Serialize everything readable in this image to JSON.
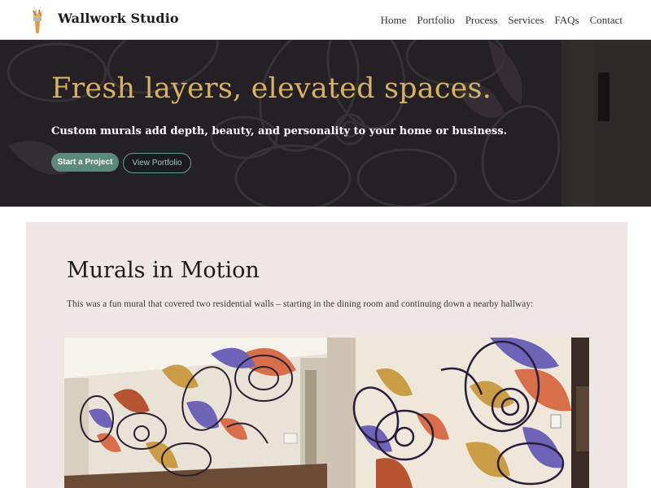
{
  "site": {
    "brand": "Wallwork Studio",
    "logo_icon": "paintbrush-icon"
  },
  "nav": {
    "items": [
      {
        "label": "Home"
      },
      {
        "label": "Portfolio"
      },
      {
        "label": "Process"
      },
      {
        "label": "Services"
      },
      {
        "label": "FAQs"
      },
      {
        "label": "Contact"
      }
    ]
  },
  "hero": {
    "title": "Fresh layers, elevated spaces.",
    "subtitle": "Custom murals add depth, beauty, and personality to your home or business.",
    "primary_button": "Start a Project",
    "secondary_button": "View Portfolio"
  },
  "section": {
    "title": "Murals in Motion",
    "text": "This was a fun mural that covered two residential walls – starting in the dining room and continuing down a nearby hallway:"
  },
  "colors": {
    "accent_gold": "#d7b25f",
    "button_green": "#5b8a7b",
    "section_bg": "#efe6e6",
    "hero_bg": "#232024"
  }
}
